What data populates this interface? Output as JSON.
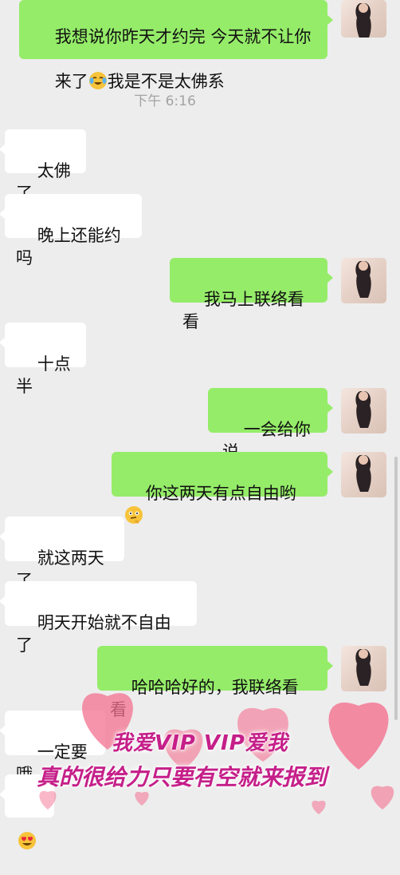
{
  "timestamp": "下午 6:16",
  "messages": [
    {
      "id": "m1",
      "side": "right",
      "text": "我想说你昨天才约完 今天就不让你",
      "text2": "来了",
      "emoji": "face-with-tears-emoji",
      "text3": "我是不是太佛系"
    },
    {
      "id": "m2",
      "side": "left",
      "text": "太佛了"
    },
    {
      "id": "m3",
      "side": "left",
      "text": "晚上还能约吗"
    },
    {
      "id": "m4",
      "side": "right",
      "text": "我马上联络看看"
    },
    {
      "id": "m5",
      "side": "left",
      "text": "十点半"
    },
    {
      "id": "m6",
      "side": "right",
      "text": "一会给你说"
    },
    {
      "id": "m7",
      "side": "right",
      "text": "你这两天有点自由哟",
      "emoji": "thinking-face-emoji"
    },
    {
      "id": "m8",
      "side": "left",
      "text": "就这两天了"
    },
    {
      "id": "m9",
      "side": "left",
      "text": "明天开始就不自由了"
    },
    {
      "id": "m10",
      "side": "right",
      "text": "哈哈哈好的，我联络看看"
    },
    {
      "id": "m11",
      "side": "left",
      "text": "一定要哦"
    },
    {
      "id": "m12",
      "side": "left",
      "emoji": "heart-eyes-emoji"
    }
  ],
  "overlay": {
    "line1": "我爱VIP VIP爱我",
    "line2": "真的很给力只要有空就来报到"
  },
  "colors": {
    "background": "#ededed",
    "right_bubble": "#95ec69",
    "left_bubble": "#ffffff",
    "overlay_text": "#c51f89",
    "heart": "#f3708f"
  }
}
